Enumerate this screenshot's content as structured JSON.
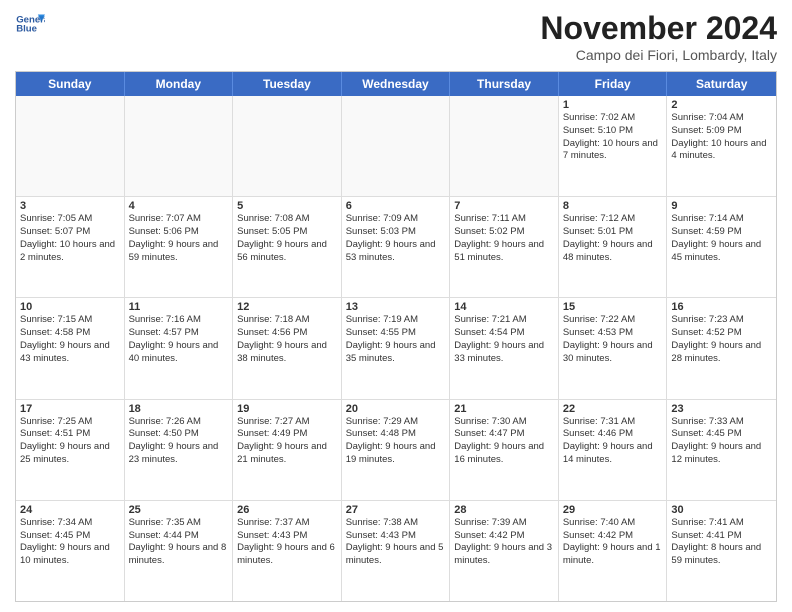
{
  "logo": {
    "line1": "General",
    "line2": "Blue"
  },
  "title": "November 2024",
  "subtitle": "Campo dei Fiori, Lombardy, Italy",
  "header": {
    "days": [
      "Sunday",
      "Monday",
      "Tuesday",
      "Wednesday",
      "Thursday",
      "Friday",
      "Saturday"
    ]
  },
  "weeks": [
    {
      "cells": [
        {
          "day": "",
          "info": ""
        },
        {
          "day": "",
          "info": ""
        },
        {
          "day": "",
          "info": ""
        },
        {
          "day": "",
          "info": ""
        },
        {
          "day": "",
          "info": ""
        },
        {
          "day": "1",
          "info": "Sunrise: 7:02 AM\nSunset: 5:10 PM\nDaylight: 10 hours\nand 7 minutes."
        },
        {
          "day": "2",
          "info": "Sunrise: 7:04 AM\nSunset: 5:09 PM\nDaylight: 10 hours\nand 4 minutes."
        }
      ]
    },
    {
      "cells": [
        {
          "day": "3",
          "info": "Sunrise: 7:05 AM\nSunset: 5:07 PM\nDaylight: 10 hours\nand 2 minutes."
        },
        {
          "day": "4",
          "info": "Sunrise: 7:07 AM\nSunset: 5:06 PM\nDaylight: 9 hours\nand 59 minutes."
        },
        {
          "day": "5",
          "info": "Sunrise: 7:08 AM\nSunset: 5:05 PM\nDaylight: 9 hours\nand 56 minutes."
        },
        {
          "day": "6",
          "info": "Sunrise: 7:09 AM\nSunset: 5:03 PM\nDaylight: 9 hours\nand 53 minutes."
        },
        {
          "day": "7",
          "info": "Sunrise: 7:11 AM\nSunset: 5:02 PM\nDaylight: 9 hours\nand 51 minutes."
        },
        {
          "day": "8",
          "info": "Sunrise: 7:12 AM\nSunset: 5:01 PM\nDaylight: 9 hours\nand 48 minutes."
        },
        {
          "day": "9",
          "info": "Sunrise: 7:14 AM\nSunset: 4:59 PM\nDaylight: 9 hours\nand 45 minutes."
        }
      ]
    },
    {
      "cells": [
        {
          "day": "10",
          "info": "Sunrise: 7:15 AM\nSunset: 4:58 PM\nDaylight: 9 hours\nand 43 minutes."
        },
        {
          "day": "11",
          "info": "Sunrise: 7:16 AM\nSunset: 4:57 PM\nDaylight: 9 hours\nand 40 minutes."
        },
        {
          "day": "12",
          "info": "Sunrise: 7:18 AM\nSunset: 4:56 PM\nDaylight: 9 hours\nand 38 minutes."
        },
        {
          "day": "13",
          "info": "Sunrise: 7:19 AM\nSunset: 4:55 PM\nDaylight: 9 hours\nand 35 minutes."
        },
        {
          "day": "14",
          "info": "Sunrise: 7:21 AM\nSunset: 4:54 PM\nDaylight: 9 hours\nand 33 minutes."
        },
        {
          "day": "15",
          "info": "Sunrise: 7:22 AM\nSunset: 4:53 PM\nDaylight: 9 hours\nand 30 minutes."
        },
        {
          "day": "16",
          "info": "Sunrise: 7:23 AM\nSunset: 4:52 PM\nDaylight: 9 hours\nand 28 minutes."
        }
      ]
    },
    {
      "cells": [
        {
          "day": "17",
          "info": "Sunrise: 7:25 AM\nSunset: 4:51 PM\nDaylight: 9 hours\nand 25 minutes."
        },
        {
          "day": "18",
          "info": "Sunrise: 7:26 AM\nSunset: 4:50 PM\nDaylight: 9 hours\nand 23 minutes."
        },
        {
          "day": "19",
          "info": "Sunrise: 7:27 AM\nSunset: 4:49 PM\nDaylight: 9 hours\nand 21 minutes."
        },
        {
          "day": "20",
          "info": "Sunrise: 7:29 AM\nSunset: 4:48 PM\nDaylight: 9 hours\nand 19 minutes."
        },
        {
          "day": "21",
          "info": "Sunrise: 7:30 AM\nSunset: 4:47 PM\nDaylight: 9 hours\nand 16 minutes."
        },
        {
          "day": "22",
          "info": "Sunrise: 7:31 AM\nSunset: 4:46 PM\nDaylight: 9 hours\nand 14 minutes."
        },
        {
          "day": "23",
          "info": "Sunrise: 7:33 AM\nSunset: 4:45 PM\nDaylight: 9 hours\nand 12 minutes."
        }
      ]
    },
    {
      "cells": [
        {
          "day": "24",
          "info": "Sunrise: 7:34 AM\nSunset: 4:45 PM\nDaylight: 9 hours\nand 10 minutes."
        },
        {
          "day": "25",
          "info": "Sunrise: 7:35 AM\nSunset: 4:44 PM\nDaylight: 9 hours\nand 8 minutes."
        },
        {
          "day": "26",
          "info": "Sunrise: 7:37 AM\nSunset: 4:43 PM\nDaylight: 9 hours\nand 6 minutes."
        },
        {
          "day": "27",
          "info": "Sunrise: 7:38 AM\nSunset: 4:43 PM\nDaylight: 9 hours\nand 5 minutes."
        },
        {
          "day": "28",
          "info": "Sunrise: 7:39 AM\nSunset: 4:42 PM\nDaylight: 9 hours\nand 3 minutes."
        },
        {
          "day": "29",
          "info": "Sunrise: 7:40 AM\nSunset: 4:42 PM\nDaylight: 9 hours\nand 1 minute."
        },
        {
          "day": "30",
          "info": "Sunrise: 7:41 AM\nSunset: 4:41 PM\nDaylight: 8 hours\nand 59 minutes."
        }
      ]
    }
  ]
}
